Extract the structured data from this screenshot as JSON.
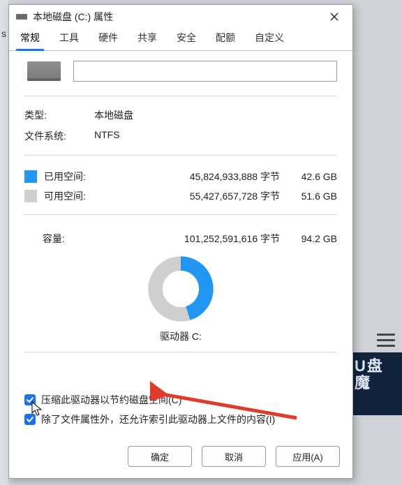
{
  "window": {
    "title": "本地磁盘 (C:) 属性",
    "close_glyph": "×"
  },
  "tabs": [
    "常规",
    "工具",
    "硬件",
    "共享",
    "安全",
    "配额",
    "自定义"
  ],
  "active_tab_index": 0,
  "general": {
    "name_value": "",
    "type_label": "类型:",
    "type_value": "本地磁盘",
    "fs_label": "文件系统:",
    "fs_value": "NTFS",
    "used_label": "已用空间:",
    "used_bytes": "45,824,933,888 字节",
    "used_human": "42.6 GB",
    "free_label": "可用空间:",
    "free_bytes": "55,427,657,728 字节",
    "free_human": "51.6 GB",
    "capacity_label": "容量:",
    "capacity_bytes": "101,252,591,616 字节",
    "capacity_human": "94.2 GB",
    "drive_caption": "驱动器 C:",
    "used_fraction": 0.453,
    "colors": {
      "used": "#2196f3",
      "free": "#cfcfcf"
    }
  },
  "checks": {
    "compress": "压缩此驱动器以节约磁盘空间(C)",
    "index": "除了文件属性外，还允许索引此驱动器上文件的内容(I)",
    "compress_checked": true,
    "index_checked": true
  },
  "buttons": {
    "ok": "确定",
    "cancel": "取消",
    "apply": "应用(A)"
  },
  "background": {
    "letter": "s",
    "bottom_right": "U盘\n魔"
  },
  "chart_data": {
    "type": "pie",
    "title": "驱动器 C:",
    "series": [
      {
        "name": "已用空间",
        "value": 45824933888,
        "human": "42.6 GB",
        "color": "#2196f3"
      },
      {
        "name": "可用空间",
        "value": 55427657728,
        "human": "51.6 GB",
        "color": "#cfcfcf"
      }
    ],
    "total": {
      "name": "容量",
      "value": 101252591616,
      "human": "94.2 GB"
    }
  }
}
